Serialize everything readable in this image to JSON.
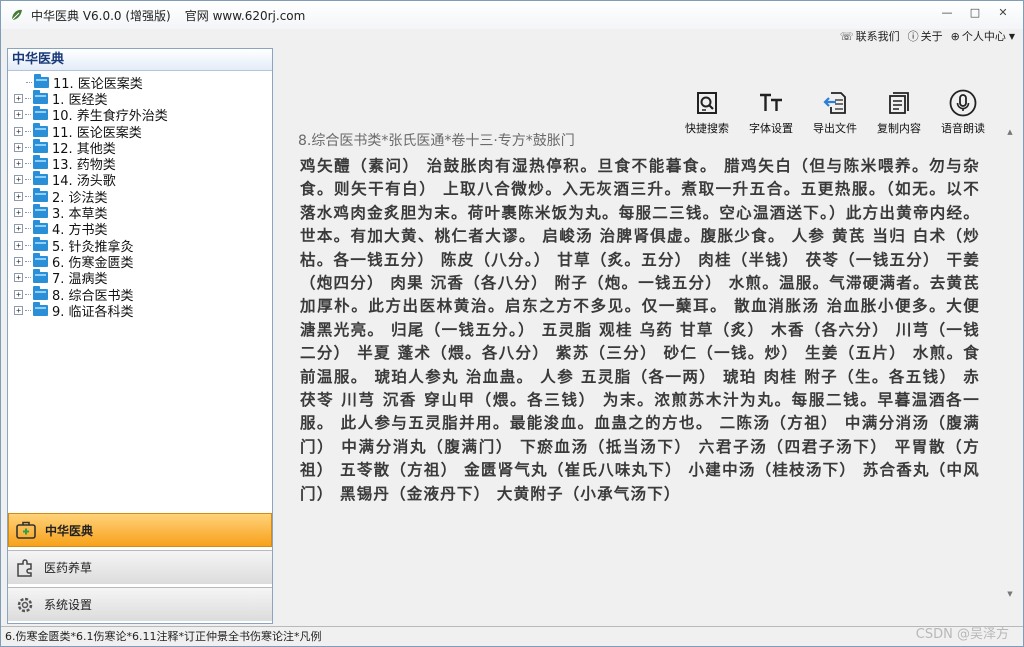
{
  "window": {
    "title": "中华医典 V6.0.0 (增强版)",
    "site": "官网 www.620rj.com",
    "controls": [
      "—",
      "□",
      "✕"
    ]
  },
  "toplinks": [
    {
      "icon": "headset-icon",
      "label": "联系我们"
    },
    {
      "icon": "info-icon",
      "label": "关于"
    },
    {
      "icon": "user-icon",
      "label": "个人中心"
    }
  ],
  "sidebar": {
    "header": "中华医典",
    "tree": [
      "11. 医论医案类",
      "1. 医经类",
      "10. 养生食疗外治类",
      "11. 医论医案类",
      "12. 其他类",
      "13. 药物类",
      "14. 汤头歌",
      "2. 诊法类",
      "3. 本草类",
      "4. 方书类",
      "5. 针灸推拿灸",
      "6. 伤寒金匮类",
      "7. 温病类",
      "8. 综合医书类",
      "9. 临证各科类"
    ],
    "nav": [
      {
        "label": "中华医典",
        "icon": "medical-kit-icon",
        "active": true
      },
      {
        "label": "医药养草",
        "icon": "puzzle-icon",
        "active": false
      },
      {
        "label": "系统设置",
        "icon": "gear-icon",
        "active": false
      }
    ]
  },
  "toolbar": [
    {
      "label": "快捷搜索",
      "icon": "search-icon"
    },
    {
      "label": "字体设置",
      "icon": "font-icon"
    },
    {
      "label": "导出文件",
      "icon": "export-icon"
    },
    {
      "label": "复制内容",
      "icon": "copy-icon"
    },
    {
      "label": "语音朗读",
      "icon": "microphone-icon"
    }
  ],
  "document": {
    "title": "8.综合医书类*张氏医通*卷十三·专方*鼓胀门",
    "body": "鸡矢醴（素问） 治鼓胀肉有湿热停积。旦食不能暮食。 腊鸡矢白（但与陈米喂养。勿与杂食。则矢干有白） 上取八合微炒。入无灰酒三升。煮取一升五合。五更热服。（如无。以不落水鸡肉金炙胆为末。荷叶裹陈米饭为丸。每服二三钱。空心温酒送下。）此方出黄帝内经。 世本。有加大黄、桃仁者大谬。 启峻汤 治脾肾俱虚。腹胀少食。 人参 黄芪 当归 白术（炒枯。各一钱五分） 陈皮（八分。） 甘草（炙。五分） 肉桂（半钱） 茯苓（一钱五分） 干姜（炮四分） 肉果 沉香（各八分） 附子（炮。一钱五分） 水煎。温服。气滞硬满者。去黄芪加厚朴。此方出医林黄治。启东之方不多见。仅一蘖耳。 散血消胀汤 治血胀小便多。大便溏黑光亮。 归尾（一钱五分。） 五灵脂 观桂 乌药 甘草（炙） 木香（各六分） 川芎（一钱二分） 半夏 蓬术（煨。各八分） 紫苏（三分） 砂仁（一钱。炒） 生姜（五片） 水煎。食前温服。 琥珀人参丸 治血蛊。 人参 五灵脂（各一两） 琥珀 肉桂 附子（生。各五钱） 赤茯苓 川芎 沉香 穿山甲（煨。各三钱） 为末。浓煎苏木汁为丸。每服二钱。早暮温酒各一服。 此人参与五灵脂并用。最能浚血。血蛊之的方也。 二陈汤（方祖） 中满分消汤（腹满门） 中满分消丸（腹满门） 下瘀血汤（抵当汤下） 六君子汤（四君子汤下） 平胃散（方祖） 五苓散（方祖） 金匮肾气丸（崔氏八味丸下） 小建中汤（桂枝汤下） 苏合香丸（中风门） 黑锡丹（金液丹下） 大黄附子（小承气汤下）"
  },
  "statusbar": "6.伤寒金匮类*6.1伤寒论*6.11注释*订正仲景全书伤寒论注*凡例",
  "watermark": "CSDN @吴泽方"
}
